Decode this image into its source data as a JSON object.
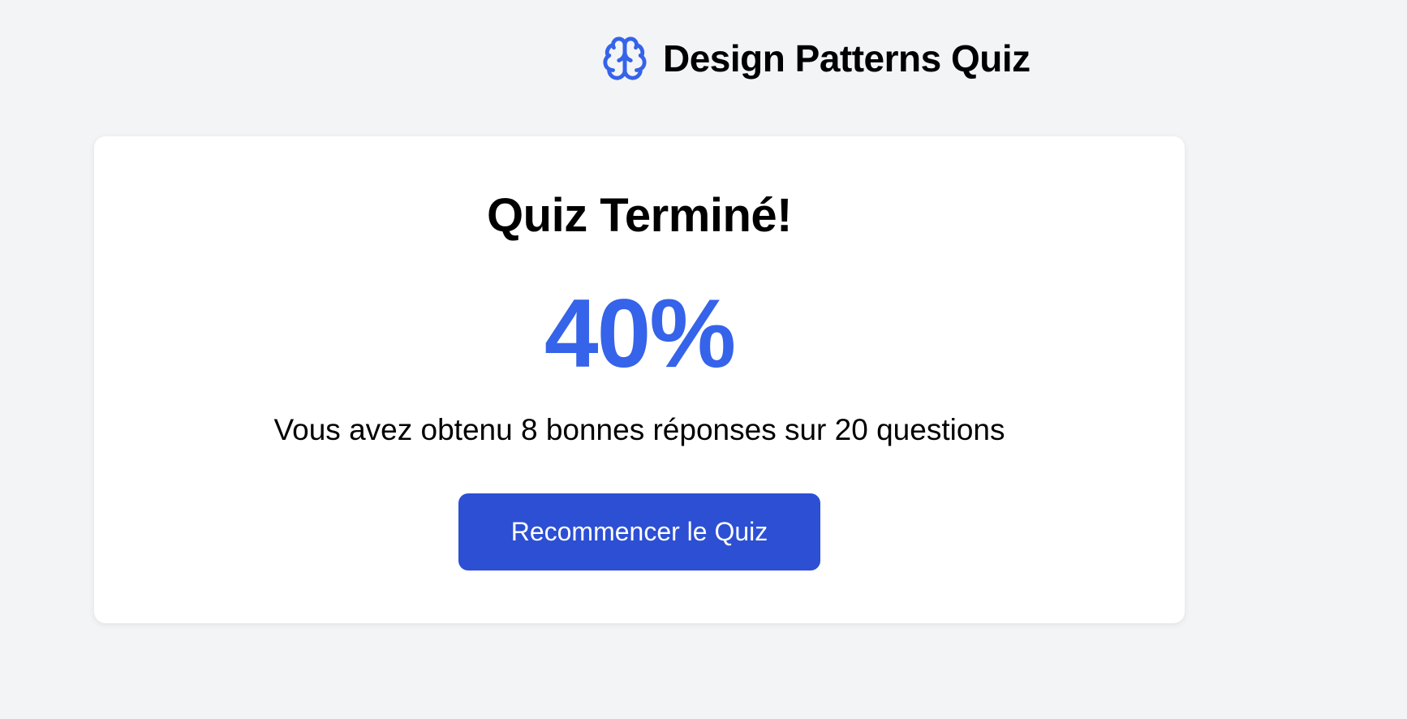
{
  "header": {
    "title": "Design Patterns Quiz",
    "icon": "brain-icon"
  },
  "result": {
    "title": "Quiz Terminé!",
    "score_text": "40%",
    "score_percent": 40,
    "summary": "Vous avez obtenu 8 bonnes réponses sur 20 questions",
    "correct_answers": 8,
    "total_questions": 20,
    "restart_label": "Recommencer le Quiz"
  },
  "colors": {
    "background": "#f3f4f6",
    "card": "#ffffff",
    "accent": "#3563e9",
    "button": "#2c4fd4",
    "button_text": "#ffffff",
    "text": "#000000"
  }
}
